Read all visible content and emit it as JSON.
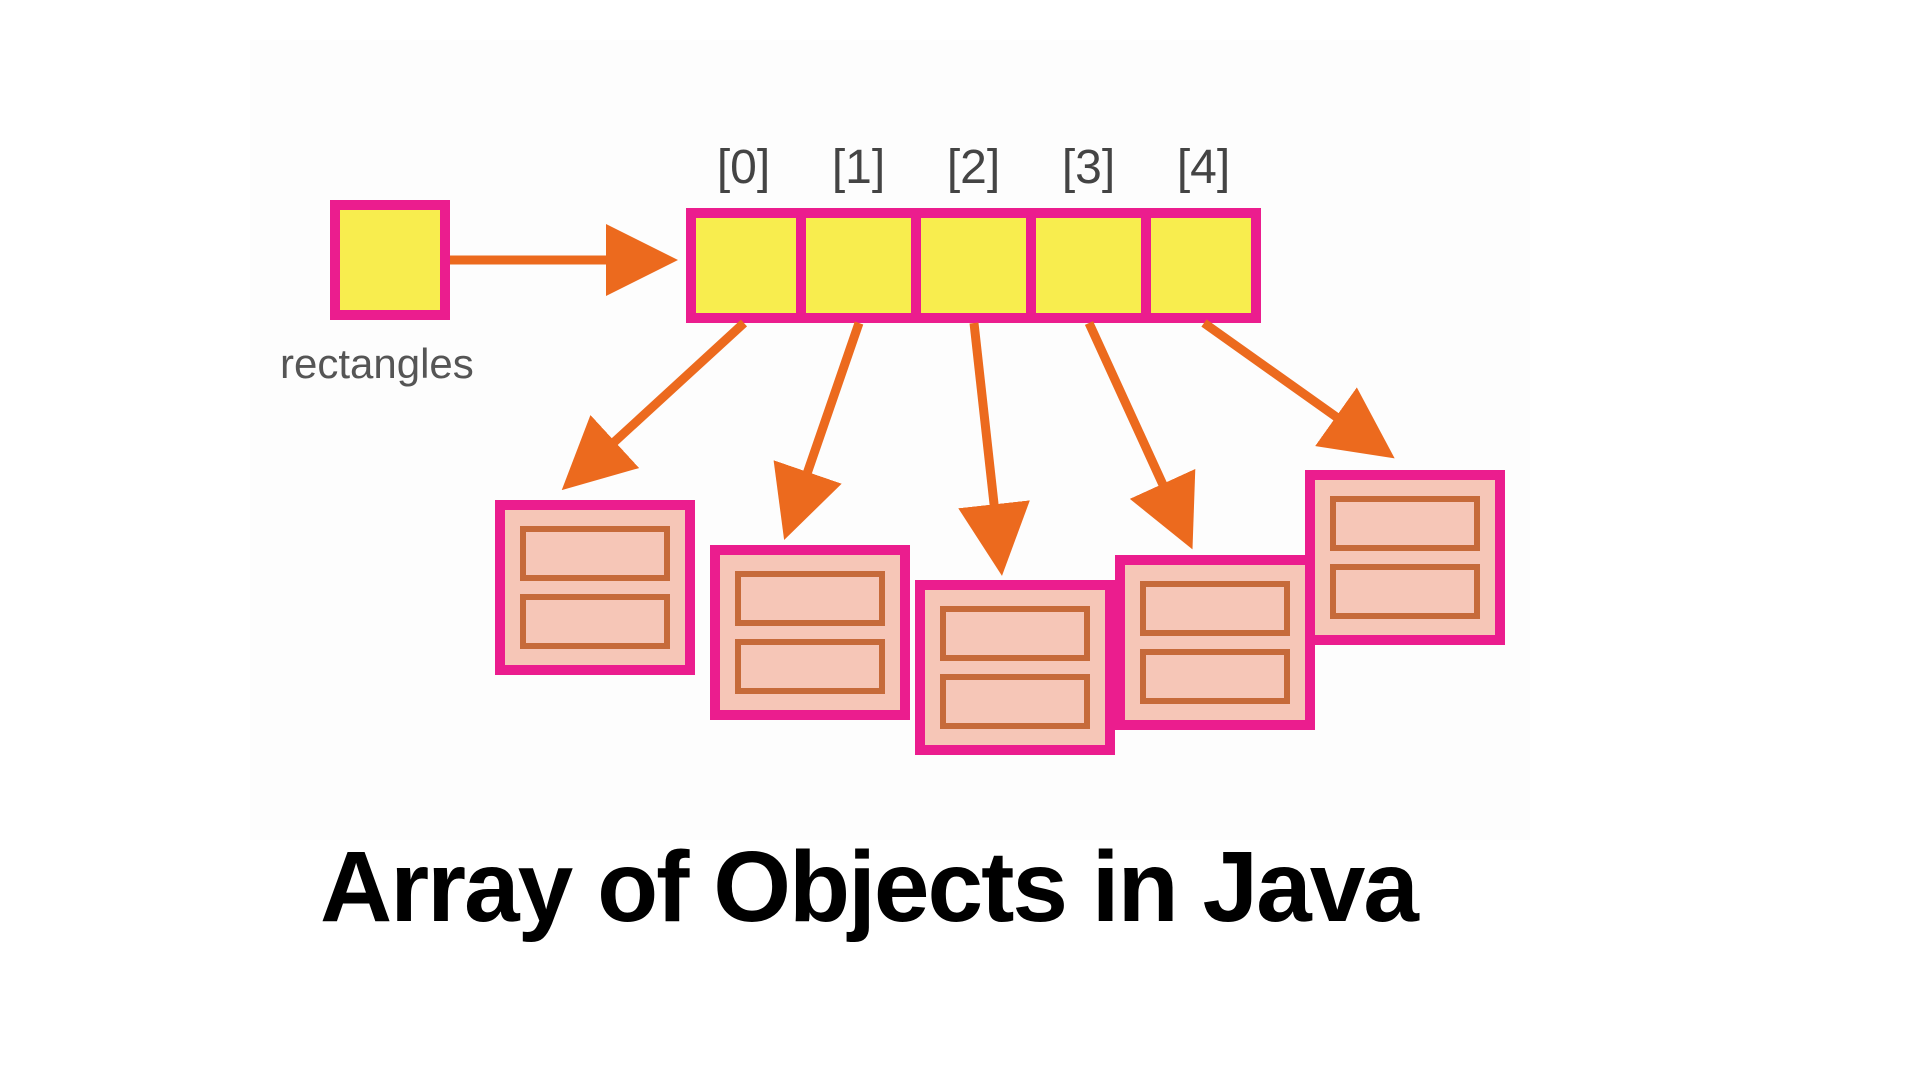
{
  "diagram": {
    "reference_label": "rectangles",
    "indices": [
      "[0]",
      "[1]",
      "[2]",
      "[3]",
      "[4]"
    ],
    "array_size": 5,
    "object_count": 5,
    "colors": {
      "cell_fill": "#f8ed4e",
      "cell_border": "#eb1d8e",
      "object_fill": "#f6c6b7",
      "object_inner_border": "#c66a3a",
      "arrow": "#ec6a1e"
    }
  },
  "title": "Array of Objects in Java"
}
